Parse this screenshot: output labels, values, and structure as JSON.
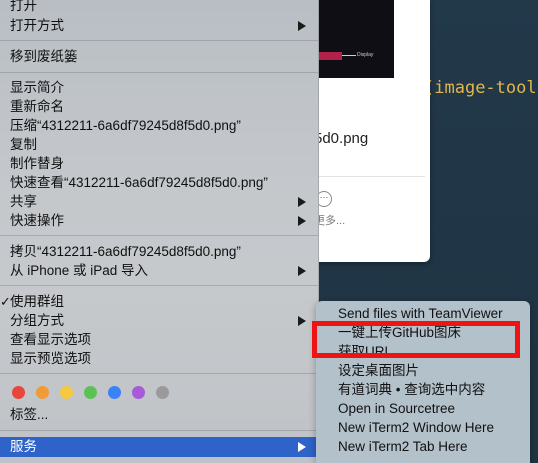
{
  "editor": {
    "code_paren_open": "(",
    "code_ident": "image-tool",
    "code_paren_close": ")",
    "code_tail": "\\"
  },
  "preview": {
    "thumb_label": "Display",
    "filename": "5d0.png",
    "more_label": "更多..."
  },
  "menu": {
    "items": [
      {
        "label": "打开",
        "submenu": false
      },
      {
        "label": "打开方式",
        "submenu": true
      },
      {
        "label": "移到废纸篓",
        "submenu": false
      },
      {
        "label": "显示简介",
        "submenu": false
      },
      {
        "label": "重新命名",
        "submenu": false
      },
      {
        "label": "压缩“4312211-6a6df79245d8f5d0.png”",
        "submenu": false
      },
      {
        "label": "复制",
        "submenu": false
      },
      {
        "label": "制作替身",
        "submenu": false
      },
      {
        "label": "快速查看“4312211-6a6df79245d8f5d0.png”",
        "submenu": false
      },
      {
        "label": "共享",
        "submenu": true
      },
      {
        "label": "快速操作",
        "submenu": true
      },
      {
        "label": "拷贝“4312211-6a6df79245d8f5d0.png”",
        "submenu": false
      },
      {
        "label": "从 iPhone 或 iPad 导入",
        "submenu": true
      },
      {
        "label": "使用群组",
        "submenu": false,
        "checked": true
      },
      {
        "label": "分组方式",
        "submenu": true
      },
      {
        "label": "查看显示选项",
        "submenu": false
      },
      {
        "label": "显示预览选项",
        "submenu": false
      },
      {
        "label": "标签...",
        "submenu": false
      },
      {
        "label": "服务",
        "submenu": true,
        "highlighted": true
      }
    ],
    "check_mark": "✓",
    "tag_colors": [
      "#e8453c",
      "#f19a38",
      "#f5c942",
      "#5ac255",
      "#3a82f6",
      "#a85bd6",
      "#9a9a9a"
    ],
    "tag_color_names": [
      "red",
      "orange",
      "yellow",
      "green",
      "blue",
      "purple",
      "gray"
    ]
  },
  "services_submenu": {
    "items": [
      "Send files with TeamViewer",
      "一键上传GitHub图床",
      "获取URL",
      "设定桌面图片",
      "有道词典 • 查询选中内容",
      "Open in Sourcetree",
      "New iTerm2 Window Here",
      "New iTerm2 Tab Here"
    ]
  },
  "colors": {
    "highlight": "#2e63c9",
    "annotation_box": "#ee1414"
  }
}
